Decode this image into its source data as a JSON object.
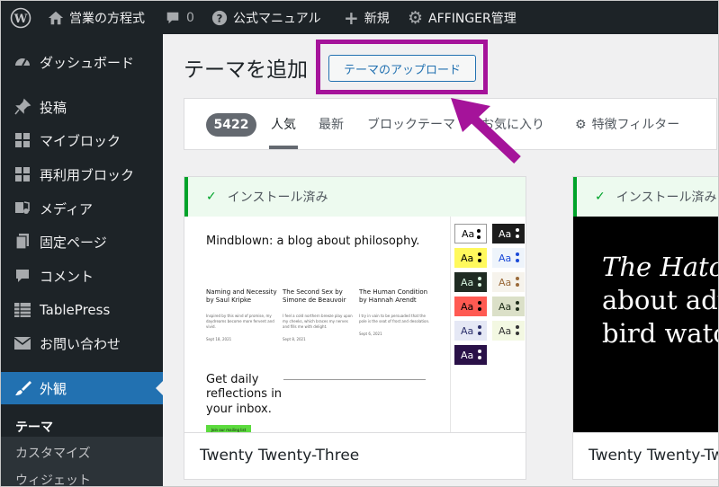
{
  "adminbar": {
    "site_name": "営業の方程式",
    "comments_count": "0",
    "manual_label": "公式マニュアル",
    "new_label": "新規",
    "affinger_label": "AFFINGER管理"
  },
  "sidebar": {
    "items": [
      {
        "label": "ダッシュボード",
        "icon": "dashboard-icon"
      },
      {
        "label": "投稿",
        "icon": "pin-icon"
      },
      {
        "label": "マイブロック",
        "icon": "blocks-icon"
      },
      {
        "label": "再利用ブロック",
        "icon": "blocks-icon"
      },
      {
        "label": "メディア",
        "icon": "media-icon"
      },
      {
        "label": "固定ページ",
        "icon": "pages-icon"
      },
      {
        "label": "コメント",
        "icon": "comment-icon"
      },
      {
        "label": "TablePress",
        "icon": "table-icon"
      },
      {
        "label": "お問い合わせ",
        "icon": "mail-icon"
      },
      {
        "label": "外観",
        "icon": "brush-icon"
      }
    ],
    "submenu": [
      "テーマ",
      "カスタマイズ",
      "ウィジェット"
    ]
  },
  "page": {
    "title": "テーマを追加",
    "upload_button": "テーマのアップロード"
  },
  "filter": {
    "count": "5422",
    "tabs": [
      "人気",
      "最新",
      "ブロックテーマ",
      "お気に入り"
    ],
    "feature_filter": "特徴フィルター"
  },
  "themes": [
    {
      "status": "インストール済み",
      "name": "Twenty Twenty-Three"
    },
    {
      "status": "インストール済み",
      "name": "Twenty Twenty-Two"
    }
  ],
  "tt3_preview": {
    "heading": "Mindblown: a blog about philosophy.",
    "posts": [
      {
        "title": "Naming and Necessity by Saul Kripke",
        "excerpt": "Inspired by this wind of promise, my daydreams become more fervent and vivid.",
        "date": "Sept 18, 2021"
      },
      {
        "title": "The Second Sex by Simone de Beauvoir",
        "excerpt": "I feel a cold northern breeze play upon my cheeks, which braces my nerves and fills me with delight.",
        "date": "Sept 8, 2021"
      },
      {
        "title": "The Human Condition by Hannah Arendt",
        "excerpt": "I try in vain to be persuaded that the pole is the seat of frost and desolation.",
        "date": "Sept 6, 2021"
      }
    ],
    "daily": "Get daily reflections in your inbox.",
    "join": "Join our mailing list",
    "swatch_label": "Aa",
    "swatches": [
      {
        "bg": "#ffffff",
        "fg": "#000000"
      },
      {
        "bg": "#1c1c1c",
        "fg": "#ffffff"
      },
      {
        "bg": "#fff95c",
        "fg": "#000000"
      },
      {
        "bg": "#eef4fb",
        "fg": "#1b4ad8"
      },
      {
        "bg": "#1f2b22",
        "fg": "#d7f5e0"
      },
      {
        "bg": "#f6f3ec",
        "fg": "#9a6a3a"
      },
      {
        "bg": "#ff5a52",
        "fg": "#000000"
      },
      {
        "bg": "#dbe0c8",
        "fg": "#1f2d1a"
      },
      {
        "bg": "#e5e8f5",
        "fg": "#2b2f6b"
      },
      {
        "bg": "#f3f8e2",
        "fg": "#333333"
      },
      {
        "bg": "#2a1148",
        "fg": "#ffffff"
      }
    ]
  },
  "tt2_preview": {
    "line1": "The Hatch",
    "line2": "about adv",
    "line3": "bird wato"
  },
  "colors": {
    "admin_dark": "#1d2327",
    "active_blue": "#2271b1",
    "highlight_magenta": "#a5139a",
    "installed_green": "#00a32a"
  }
}
